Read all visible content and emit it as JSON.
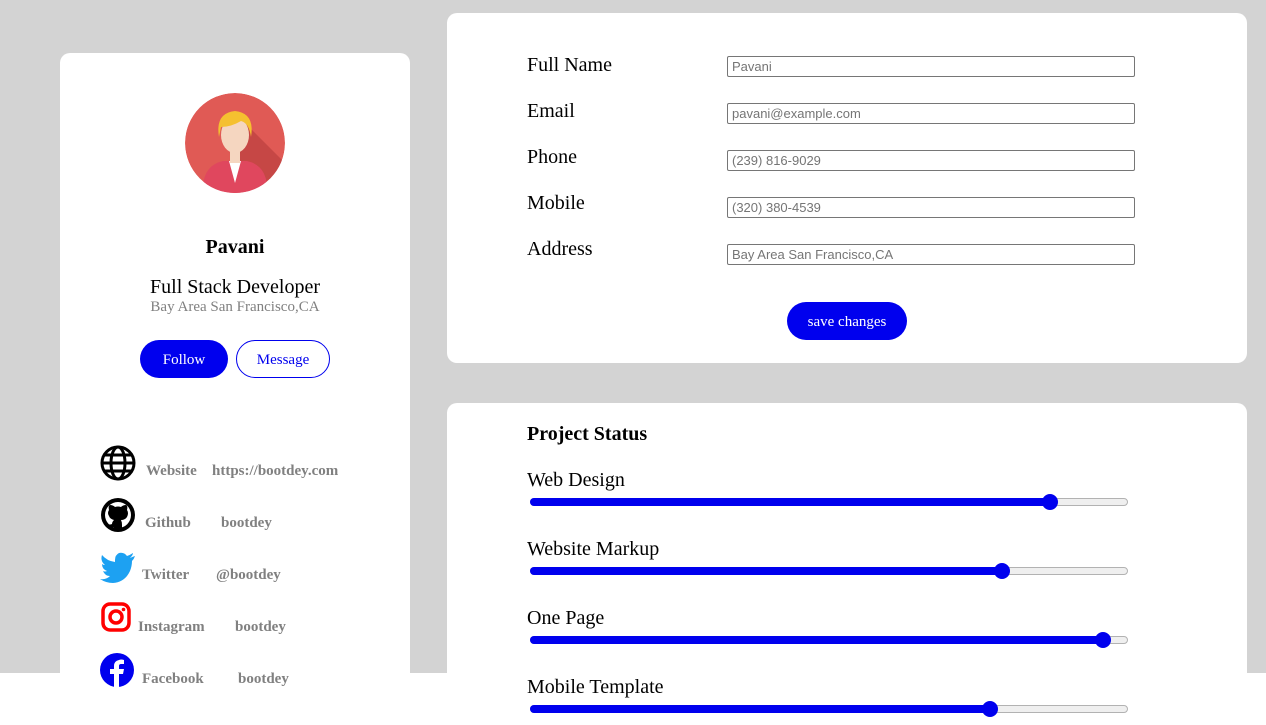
{
  "profile": {
    "name": "Pavani",
    "role": "Full Stack Developer",
    "location": "Bay Area San Francisco,CA",
    "follow_label": "Follow",
    "message_label": "Message",
    "social": [
      {
        "icon": "globe-icon",
        "label": "Website",
        "value": "https://bootdey.com"
      },
      {
        "icon": "github-icon",
        "label": "Github",
        "value": "bootdey"
      },
      {
        "icon": "twitter-icon",
        "label": "Twitter",
        "value": "@bootdey"
      },
      {
        "icon": "instagram-icon",
        "label": "Instagram",
        "value": "bootdey"
      },
      {
        "icon": "facebook-icon",
        "label": "Facebook",
        "value": "bootdey"
      }
    ]
  },
  "form": {
    "fields": [
      {
        "label": "Full Name",
        "placeholder": "Pavani"
      },
      {
        "label": "Email",
        "placeholder": "pavani@example.com"
      },
      {
        "label": "Phone",
        "placeholder": "(239) 816-9029"
      },
      {
        "label": "Mobile",
        "placeholder": "(320) 380-4539"
      },
      {
        "label": "Address",
        "placeholder": "Bay Area San Francisco,CA"
      }
    ],
    "save_label": "save changes"
  },
  "project_status": {
    "title": "Project Status",
    "items": [
      {
        "label": "Web Design",
        "value": 0.87
      },
      {
        "label": "Website Markup",
        "value": 0.79
      },
      {
        "label": "One Page",
        "value": 0.96
      },
      {
        "label": "Mobile Template",
        "value": 0.77
      }
    ]
  },
  "colors": {
    "accent": "#0000ee",
    "background": "#d3d3d3",
    "muted_text": "#808080",
    "twitter": "#1da1f2",
    "instagram": "#ff0000"
  }
}
